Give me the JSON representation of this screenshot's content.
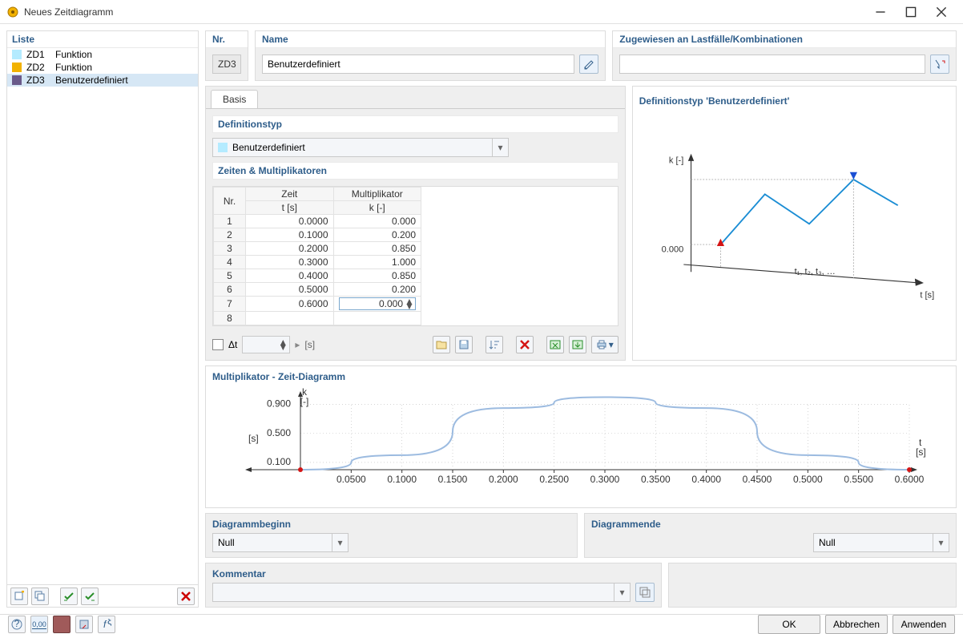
{
  "window": {
    "title": "Neues Zeitdiagramm"
  },
  "sidebar": {
    "header": "Liste",
    "items": [
      {
        "code": "ZD1",
        "label": "Funktion",
        "color": "#b4ebff"
      },
      {
        "code": "ZD2",
        "label": "Funktion",
        "color": "#f2b200"
      },
      {
        "code": "ZD3",
        "label": "Benutzerdefiniert",
        "color": "#6a5a8a"
      }
    ]
  },
  "header_panels": {
    "nr_label": "Nr.",
    "nr_value": "ZD3",
    "name_label": "Name",
    "name_value": "Benutzerdefiniert",
    "assign_label": "Zugewiesen an Lastfälle/Kombinationen"
  },
  "tabs": {
    "basis": "Basis"
  },
  "definition_type": {
    "header": "Definitionstyp",
    "value": "Benutzerdefiniert",
    "swatch": "#b4ebff"
  },
  "times_multipliers": {
    "header": "Zeiten & Multiplikatoren",
    "cols": {
      "nr": "Nr.",
      "zeit1": "Zeit",
      "zeit2": "t [s]",
      "mult1": "Multiplikator",
      "mult2": "k [-]"
    }
  },
  "chart_data": {
    "type": "line",
    "title": "Multiplikator - Zeit-Diagramm",
    "xlabel": "t [s]",
    "ylabel": "k [-]",
    "x": [
      0.0,
      0.1,
      0.2,
      0.3,
      0.4,
      0.5,
      0.6
    ],
    "y": [
      0.0,
      0.2,
      0.85,
      1.0,
      0.85,
      0.2,
      0.0
    ],
    "x_ticks": [
      "0.0500",
      "0.1000",
      "0.1500",
      "0.2000",
      "0.2500",
      "0.3000",
      "0.3500",
      "0.4000",
      "0.4500",
      "0.5000",
      "0.5500",
      "0.6000"
    ],
    "y_ticks": [
      "0.100",
      "0.500",
      "0.900"
    ],
    "xlim": [
      0.0,
      0.6
    ],
    "ylim": [
      0.0,
      1.05
    ]
  },
  "preview": {
    "header_prefix": "Definitionstyp",
    "k_label": "k [-]",
    "t_label": "t [s]",
    "zero": "0.000",
    "t_ticks": "t₁, t₂, t₃, …"
  },
  "dt": {
    "label": "Δt",
    "unit": "[s]"
  },
  "diagram_start": {
    "label": "Diagrammbeginn",
    "value": "Null"
  },
  "diagram_end": {
    "label": "Diagrammende",
    "value": "Null"
  },
  "comment": {
    "label": "Kommentar"
  },
  "buttons": {
    "ok": "OK",
    "cancel": "Abbrechen",
    "apply": "Anwenden"
  }
}
